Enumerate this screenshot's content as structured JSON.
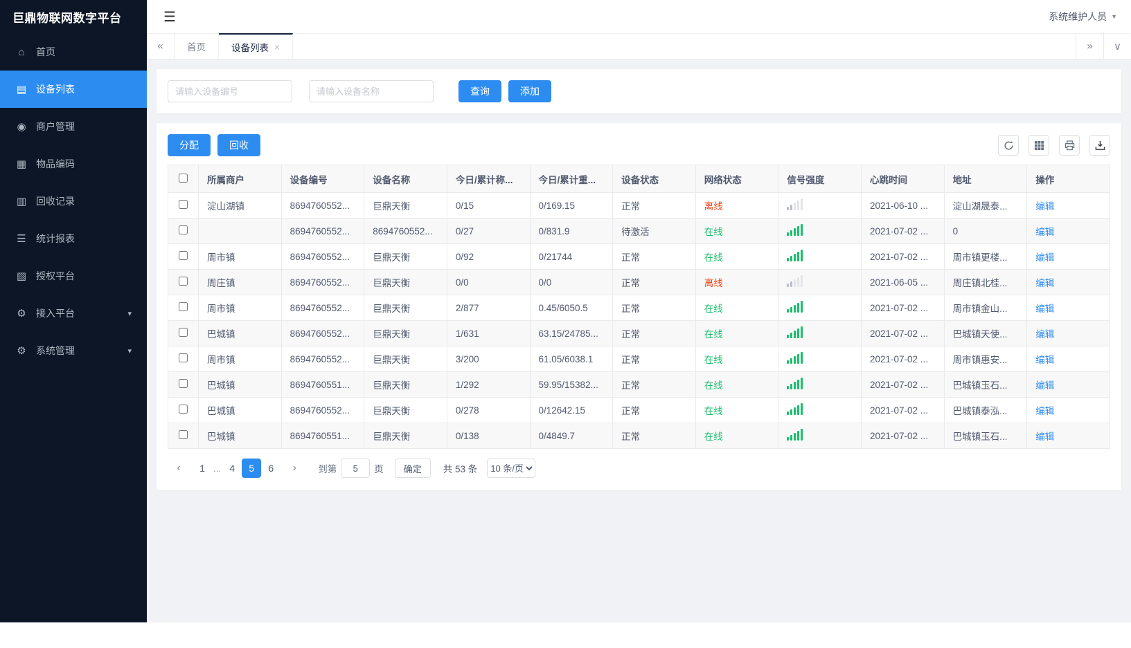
{
  "app": {
    "title": "巨鼎物联网数字平台",
    "user": "系统维护人员"
  },
  "colors": {
    "accent": "#2d8cf0",
    "online": "#19be6b",
    "offline": "#ed4014",
    "sidebar_bg": "#0c1626"
  },
  "sidebar": {
    "items": [
      {
        "id": "home",
        "label": "首页",
        "icon": "home-icon",
        "glyph": "⌂",
        "active": false,
        "expandable": false
      },
      {
        "id": "device-list",
        "label": "设备列表",
        "icon": "list-icon",
        "glyph": "▤",
        "active": true,
        "expandable": false
      },
      {
        "id": "merchant-management",
        "label": "商户管理",
        "icon": "person-icon",
        "glyph": "◉",
        "active": false,
        "expandable": false
      },
      {
        "id": "item-code",
        "label": "物品编码",
        "icon": "document-icon",
        "glyph": "▦",
        "active": false,
        "expandable": false
      },
      {
        "id": "recycle-record",
        "label": "回收记录",
        "icon": "document-icon",
        "glyph": "▥",
        "active": false,
        "expandable": false
      },
      {
        "id": "statistics-report",
        "label": "统计报表",
        "icon": "report-icon",
        "glyph": "☰",
        "active": false,
        "expandable": false
      },
      {
        "id": "authorization-platform",
        "label": "授权平台",
        "icon": "document-icon",
        "glyph": "▧",
        "active": false,
        "expandable": false
      },
      {
        "id": "access-platform",
        "label": "接入平台",
        "icon": "gear-icon",
        "glyph": "⚙",
        "active": false,
        "expandable": true
      },
      {
        "id": "system-management",
        "label": "系统管理",
        "icon": "gear-icon",
        "glyph": "⚙",
        "active": false,
        "expandable": true
      }
    ]
  },
  "tabs": {
    "items": [
      {
        "id": "home",
        "label": "首页",
        "active": false,
        "closable": false
      },
      {
        "id": "device-list",
        "label": "设备列表",
        "active": true,
        "closable": true
      }
    ]
  },
  "search": {
    "device_no_placeholder": "请输入设备编号",
    "device_name_placeholder": "请输入设备名称",
    "query_label": "查询",
    "add_label": "添加"
  },
  "toolbar": {
    "assign_label": "分配",
    "recycle_label": "回收"
  },
  "table": {
    "columns": [
      "所属商户",
      "设备编号",
      "设备名称",
      "今日/累计称...",
      "今日/累计重...",
      "设备状态",
      "网络状态",
      "信号强度",
      "心跳时间",
      "地址",
      "操作"
    ],
    "rows": [
      {
        "merchant": "淀山湖镇",
        "device_no": "8694760552...",
        "device_name": "巨鼎天衡",
        "today_count": "0/15",
        "today_weight": "0/169.15",
        "device_status": "正常",
        "network_status": "离线",
        "network_type": "offline",
        "heartbeat": "2021-06-10 ...",
        "address": "淀山湖晟泰...",
        "action": "编辑"
      },
      {
        "merchant": "",
        "device_no": "8694760552...",
        "device_name": "8694760552...",
        "today_count": "0/27",
        "today_weight": "0/831.9",
        "device_status": "待激活",
        "network_status": "在线",
        "network_type": "online",
        "heartbeat": "2021-07-02 ...",
        "address": "0",
        "action": "编辑"
      },
      {
        "merchant": "周市镇",
        "device_no": "8694760552...",
        "device_name": "巨鼎天衡",
        "today_count": "0/92",
        "today_weight": "0/21744",
        "device_status": "正常",
        "network_status": "在线",
        "network_type": "online",
        "heartbeat": "2021-07-02 ...",
        "address": "周市镇更楼...",
        "action": "编辑"
      },
      {
        "merchant": "周庄镇",
        "device_no": "8694760552...",
        "device_name": "巨鼎天衡",
        "today_count": "0/0",
        "today_weight": "0/0",
        "device_status": "正常",
        "network_status": "离线",
        "network_type": "offline",
        "heartbeat": "2021-06-05 ...",
        "address": "周庄镇北桂...",
        "action": "编辑"
      },
      {
        "merchant": "周市镇",
        "device_no": "8694760552...",
        "device_name": "巨鼎天衡",
        "today_count": "2/877",
        "today_weight": "0.45/6050.5",
        "device_status": "正常",
        "network_status": "在线",
        "network_type": "online",
        "heartbeat": "2021-07-02 ...",
        "address": "周市镇金山...",
        "action": "编辑"
      },
      {
        "merchant": "巴城镇",
        "device_no": "8694760552...",
        "device_name": "巨鼎天衡",
        "today_count": "1/631",
        "today_weight": "63.15/24785...",
        "device_status": "正常",
        "network_status": "在线",
        "network_type": "online",
        "heartbeat": "2021-07-02 ...",
        "address": "巴城镇天使...",
        "action": "编辑"
      },
      {
        "merchant": "周市镇",
        "device_no": "8694760552...",
        "device_name": "巨鼎天衡",
        "today_count": "3/200",
        "today_weight": "61.05/6038.1",
        "device_status": "正常",
        "network_status": "在线",
        "network_type": "online",
        "heartbeat": "2021-07-02 ...",
        "address": "周市镇惠安...",
        "action": "编辑"
      },
      {
        "merchant": "巴城镇",
        "device_no": "8694760551...",
        "device_name": "巨鼎天衡",
        "today_count": "1/292",
        "today_weight": "59.95/15382...",
        "device_status": "正常",
        "network_status": "在线",
        "network_type": "online",
        "heartbeat": "2021-07-02 ...",
        "address": "巴城镇玉石...",
        "action": "编辑"
      },
      {
        "merchant": "巴城镇",
        "device_no": "8694760552...",
        "device_name": "巨鼎天衡",
        "today_count": "0/278",
        "today_weight": "0/12642.15",
        "device_status": "正常",
        "network_status": "在线",
        "network_type": "online",
        "heartbeat": "2021-07-02 ...",
        "address": "巴城镇泰泓...",
        "action": "编辑"
      },
      {
        "merchant": "巴城镇",
        "device_no": "8694760551...",
        "device_name": "巨鼎天衡",
        "today_count": "0/138",
        "today_weight": "0/4849.7",
        "device_status": "正常",
        "network_status": "在线",
        "network_type": "online",
        "heartbeat": "2021-07-02 ...",
        "address": "巴城镇玉石...",
        "action": "编辑"
      }
    ]
  },
  "pagination": {
    "pages": [
      "1",
      "...",
      "4",
      "5",
      "6"
    ],
    "active_page": "5",
    "jump_label": "到第",
    "jump_value": "5",
    "page_unit": "页",
    "confirm_label": "确定",
    "total_text": "共 53 条",
    "page_size": "10 条/页"
  }
}
